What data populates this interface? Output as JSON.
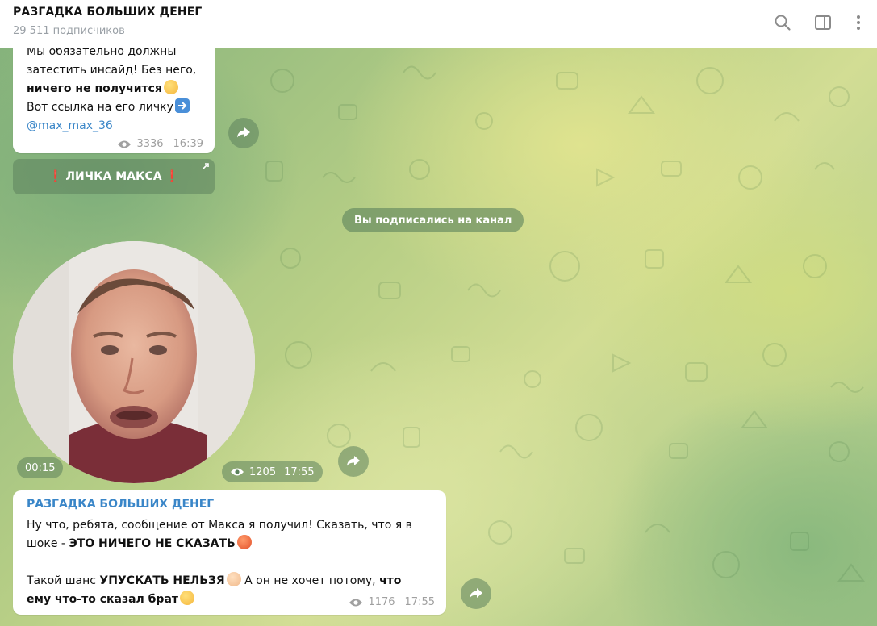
{
  "header": {
    "title": "РАЗГАДКА БОЛЬШИХ ДЕНЕГ",
    "subtitle": "29 511 подписчиков",
    "icons": [
      "search-icon",
      "sidebar-icon",
      "more-icon"
    ]
  },
  "messages": {
    "first": {
      "line1": "Мы обязательно должны",
      "line2": "затестить инсайд! Без него,",
      "line3": "ничего не получится",
      "line4": "Вот ссылка на его личку",
      "link": "@max_max_36",
      "views": "3336",
      "time": "16:39"
    },
    "button": {
      "label": "ЛИЧКА МАКСА"
    },
    "service": "Вы подписались на канал",
    "video": {
      "duration": "00:15",
      "views": "1205",
      "time": "17:55"
    },
    "last": {
      "author": "РАЗГАДКА БОЛЬШИХ ДЕНЕГ",
      "p1_line1": "Ну что, ребята, сообщение от Макса я получил! Сказать, что я в",
      "p1_line2_a": "шоке - ",
      "p1_line2_b": "ЭТО НИЧЕГО НЕ СКАЗАТЬ",
      "p2_line1_a": "Такой шанс ",
      "p2_line1_b": "УПУСКАТЬ НЕЛЬЗЯ",
      "p2_line1_c": " А он не хочет потому, ",
      "p2_line1_d": "что",
      "p2_line2": "ему что-то сказал брат",
      "views": "1176",
      "time": "17:55"
    }
  },
  "colors": {
    "accent": "#3a86c8",
    "bubble": "#ffffff",
    "overlay": "#5c825c"
  }
}
